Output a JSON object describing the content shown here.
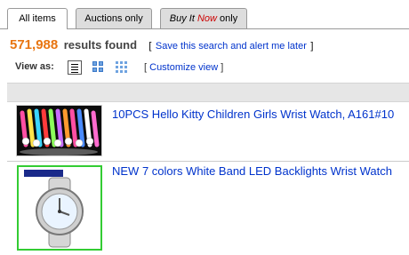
{
  "tabs": [
    {
      "label": "All items",
      "active": true
    },
    {
      "label": "Auctions only",
      "active": false
    },
    {
      "label_prefix": "Buy It",
      "label_now": "Now",
      "label_suffix": "only",
      "active": false
    }
  ],
  "results": {
    "count": "571,988",
    "found_label": "results found",
    "bracket_open": "[",
    "save_link": "Save this search and alert me later",
    "bracket_close": "]"
  },
  "view": {
    "label": "View as:",
    "options": [
      "list-view-icon",
      "gallery-view-icon",
      "grid-view-icon"
    ],
    "customize_open": "[",
    "customize_link": "Customize view",
    "customize_close": "]"
  },
  "listings": [
    {
      "title": "10PCS Hello Kitty Children Girls Wrist Watch, A161#10",
      "thumb_icon": "hello-kitty-watches-photo"
    },
    {
      "title": "NEW 7 colors White Band LED Backlights Wrist Watch",
      "thumb_icon": "white-led-watch-photo",
      "thumb_brand": "brand logo"
    }
  ],
  "colors": {
    "count": "#e87511",
    "link": "#0033cc",
    "now": "#cc0000",
    "selected_thumb_border": "#33cc33"
  }
}
